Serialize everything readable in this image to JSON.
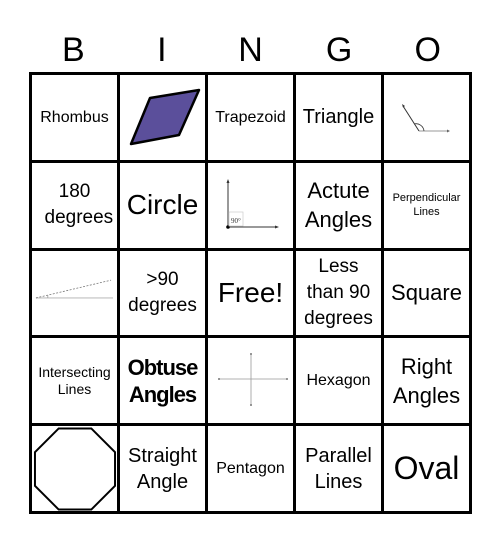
{
  "header": {
    "letters": [
      "B",
      "I",
      "N",
      "G",
      "O"
    ]
  },
  "cells": {
    "r0c0": "Rhombus",
    "r0c1": "rhombus-shape",
    "r0c2": "Trapezoid",
    "r0c3": "Triangle",
    "r0c4": "obtuse-angle-diagram",
    "r1c0": "180 degrees",
    "r1c1": "Circle",
    "r1c2": "right-angle-diagram",
    "r1c2_label": "90°",
    "r1c3": "Actute Angles",
    "r1c4": "Perpendicular Lines",
    "r2c0": "acute-angle-diagram",
    "r2c1": ">90 degrees",
    "r2c2": "Free!",
    "r2c3": "Less than 90 degrees",
    "r2c4": "Square",
    "r3c0": "Intersecting Lines",
    "r3c1": "Obtuse Angles",
    "r3c2": "perpendicular-lines-diagram",
    "r3c3": "Hexagon",
    "r3c4": "Right Angles",
    "r4c0": "octagon-shape",
    "r4c1": "Straight Angle",
    "r4c2": "Pentagon",
    "r4c3": "Parallel Lines",
    "r4c4": "Oval"
  },
  "colors": {
    "rhombus_fill": "#5b4f9b"
  }
}
